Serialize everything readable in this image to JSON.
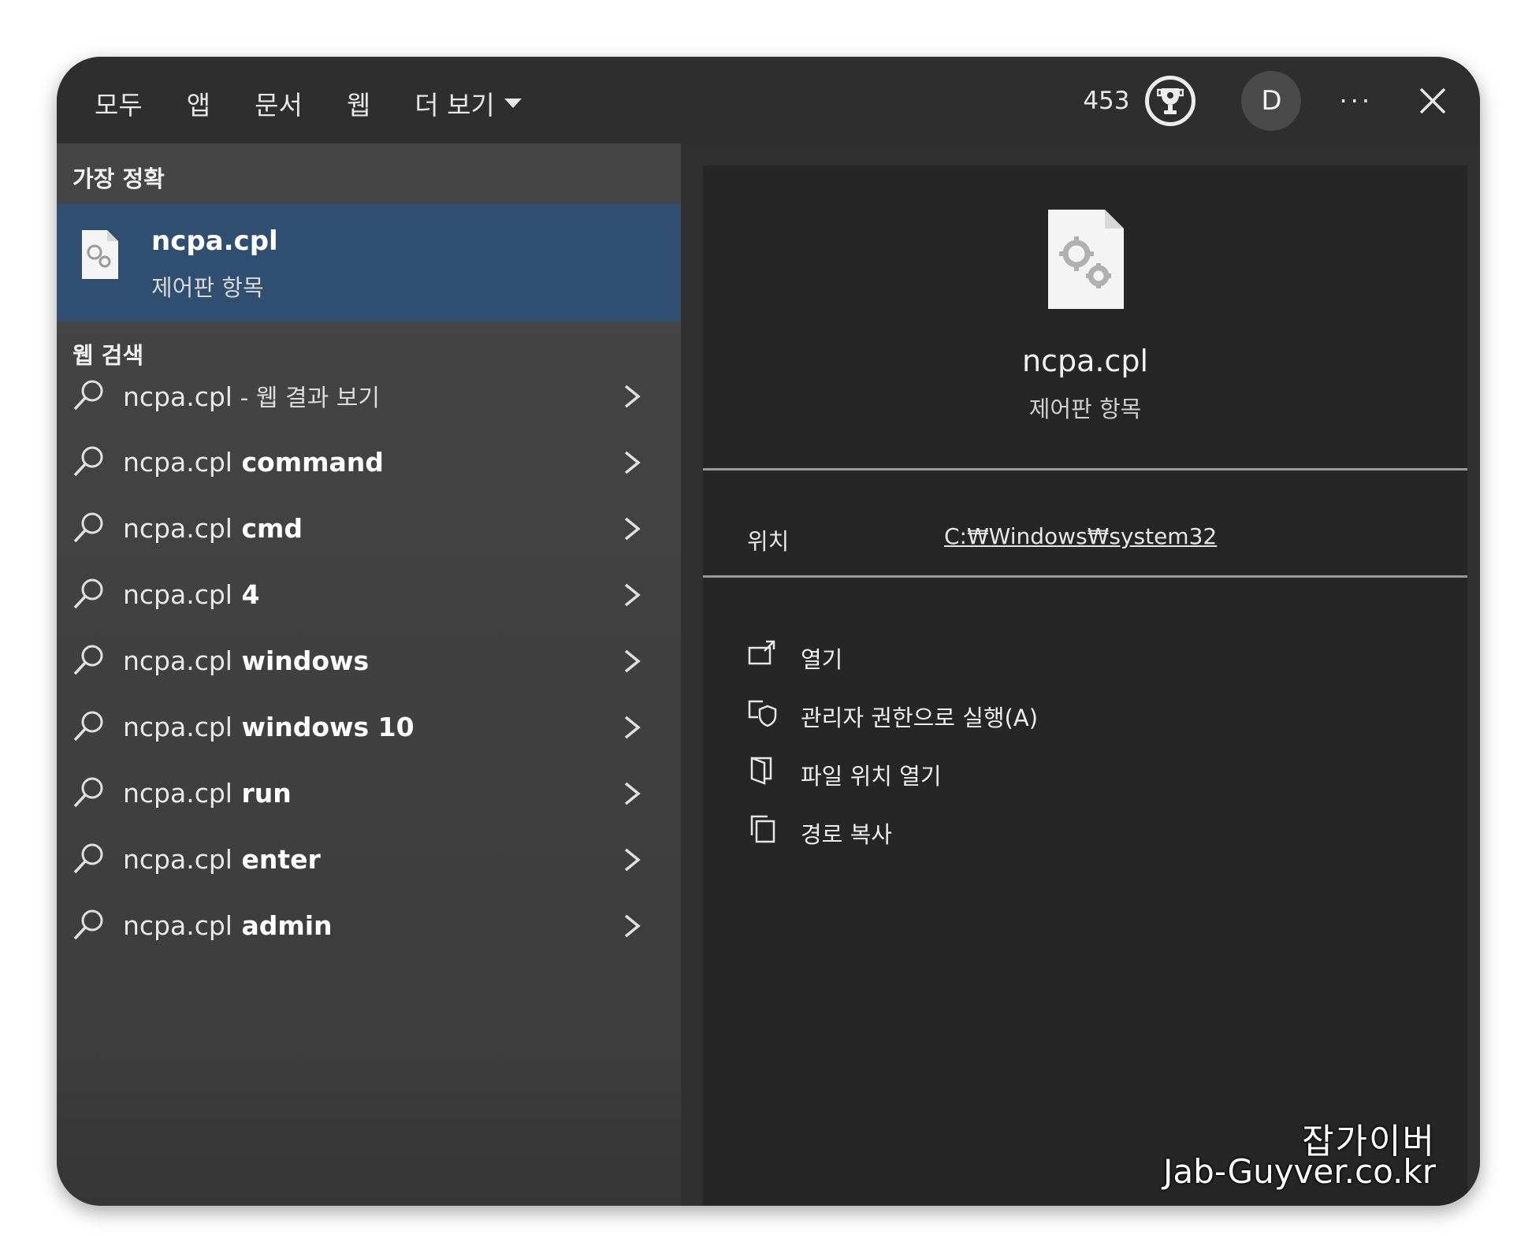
{
  "tabs": [
    {
      "label": "모두"
    },
    {
      "label": "앱"
    },
    {
      "label": "문서"
    },
    {
      "label": "웹"
    },
    {
      "label": "더 보기"
    }
  ],
  "topbar": {
    "points": "453",
    "avatar_initial": "D",
    "more_label": "···"
  },
  "left": {
    "best_match_title": "가장 정확",
    "best_match": {
      "name": "ncpa.cpl",
      "subtitle": "제어판 항목"
    },
    "web_search_title": "웹 검색",
    "web_items": [
      {
        "query": "ncpa.cpl",
        "suffix": " - 웹 결과 보기"
      },
      {
        "query": "ncpa.cpl",
        "suffix": " command"
      },
      {
        "query": "ncpa.cpl",
        "suffix": " cmd"
      },
      {
        "query": "ncpa.cpl",
        "suffix": " 4"
      },
      {
        "query": "ncpa.cpl",
        "suffix": " windows"
      },
      {
        "query": "ncpa.cpl",
        "suffix": " windows 10"
      },
      {
        "query": "ncpa.cpl",
        "suffix": " run"
      },
      {
        "query": "ncpa.cpl",
        "suffix": " enter"
      },
      {
        "query": "ncpa.cpl",
        "suffix": " admin"
      }
    ]
  },
  "right": {
    "name": "ncpa.cpl",
    "subtitle": "제어판 항목",
    "location_label": "위치",
    "location_value": "C:₩Windows₩system32",
    "actions": [
      {
        "label": "열기",
        "icon": "open-icon"
      },
      {
        "label": "관리자 권한으로 실행(A)",
        "icon": "admin-shield-icon"
      },
      {
        "label": "파일 위치 열기",
        "icon": "folder-icon"
      },
      {
        "label": "경로 복사",
        "icon": "copy-icon"
      }
    ]
  },
  "watermark": {
    "line1": "잡가이버",
    "line2": "Jab-Guyver.co.kr"
  },
  "colors": {
    "accent": "#4aa6ff",
    "selection": "#2f4e70",
    "panel_dark": "#262626"
  }
}
